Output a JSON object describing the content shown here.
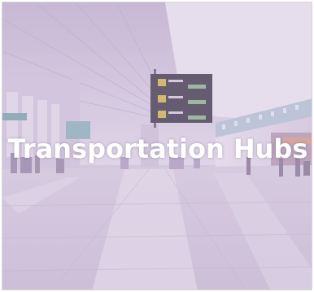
{
  "tile": {
    "title": "Transportation Hubs",
    "overlay_color": "#c9b6d8"
  }
}
